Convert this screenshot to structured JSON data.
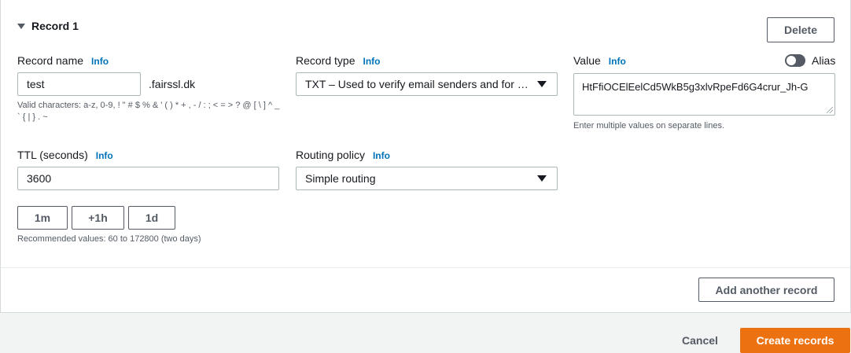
{
  "record": {
    "title": "Record 1",
    "delete_label": "Delete",
    "record_name": {
      "label": "Record name",
      "info": "Info",
      "value": "test",
      "suffix": ".fairssl.dk",
      "hint": "Valid characters: a-z, 0-9, ! \" # $ % & ' ( ) * + , - / : ; < = > ? @ [ \\ ] ^ _ ` { | } . ~"
    },
    "record_type": {
      "label": "Record type",
      "info": "Info",
      "selected": "TXT – Used to verify email senders and for application-specific values"
    },
    "value": {
      "label": "Value",
      "info": "Info",
      "text": "HtFfiOCElEelCd5WkB5g3xlvRpeFd6G4crur_Jh-G",
      "hint": "Enter multiple values on separate lines.",
      "alias_label": "Alias",
      "alias_on": false
    },
    "ttl": {
      "label": "TTL (seconds)",
      "info": "Info",
      "value": "3600",
      "presets": [
        "1m",
        "+1h",
        "1d"
      ],
      "hint": "Recommended values: 60 to 172800 (two days)"
    },
    "routing_policy": {
      "label": "Routing policy",
      "info": "Info",
      "selected": "Simple routing"
    }
  },
  "actions": {
    "add_another": "Add another record",
    "cancel": "Cancel",
    "create": "Create records"
  },
  "colors": {
    "primary": "#ec7211",
    "link": "#0073bb",
    "border": "#aab7b8"
  }
}
